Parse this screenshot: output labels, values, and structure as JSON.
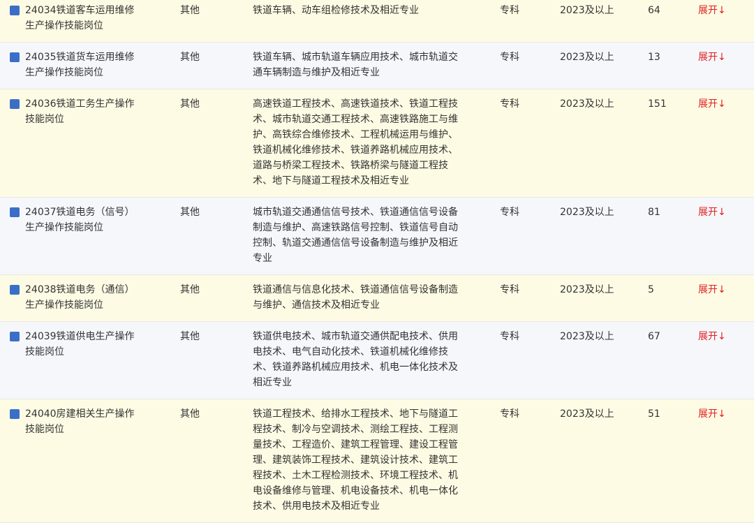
{
  "colors": {
    "row_odd_bg": "#fefbe4",
    "row_even_bg": "#f6f7fb",
    "marker": "#3b6fc7",
    "expand_link": "#e02020"
  },
  "expand_icon": "down-arrow-icon",
  "rows": [
    {
      "name": "24034铁道客车运用维修生产操作技能岗位",
      "type": "其他",
      "major": "铁道车辆、动车组检修技术及相近专业",
      "education": "专科",
      "year": "2023及以上",
      "count": "64",
      "action": "展开↓"
    },
    {
      "name": "24035铁道货车运用维修生产操作技能岗位",
      "type": "其他",
      "major": "铁道车辆、城市轨道车辆应用技术、城市轨道交通车辆制造与维护及相近专业",
      "education": "专科",
      "year": "2023及以上",
      "count": "13",
      "action": "展开↓"
    },
    {
      "name": "24036铁道工务生产操作技能岗位",
      "type": "其他",
      "major": "高速铁道工程技术、高速铁道技术、铁道工程技术、城市轨道交通工程技术、高速铁路施工与维护、高铁综合维修技术、工程机械运用与维护、铁道机械化维修技术、铁道养路机械应用技术、道路与桥梁工程技术、铁路桥梁与隧道工程技术、地下与隧道工程技术及相近专业",
      "education": "专科",
      "year": "2023及以上",
      "count": "151",
      "action": "展开↓"
    },
    {
      "name": "24037铁道电务（信号）生产操作技能岗位",
      "type": "其他",
      "major": "城市轨道交通通信信号技术、铁道通信信号设备制造与维护、高速铁路信号控制、铁道信号自动控制、轨道交通通信信号设备制造与维护及相近专业",
      "education": "专科",
      "year": "2023及以上",
      "count": "81",
      "action": "展开↓"
    },
    {
      "name": "24038铁道电务（通信）生产操作技能岗位",
      "type": "其他",
      "major": "铁道通信与信息化技术、铁道通信信号设备制造与维护、通信技术及相近专业",
      "education": "专科",
      "year": "2023及以上",
      "count": "5",
      "action": "展开↓"
    },
    {
      "name": "24039铁道供电生产操作技能岗位",
      "type": "其他",
      "major": "铁道供电技术、城市轨道交通供配电技术、供用电技术、电气自动化技术、铁道机械化维修技术、铁道养路机械应用技术、机电一体化技术及相近专业",
      "education": "专科",
      "year": "2023及以上",
      "count": "67",
      "action": "展开↓"
    },
    {
      "name": "24040房建相关生产操作技能岗位",
      "type": "其他",
      "major": "铁道工程技术、给排水工程技术、地下与隧道工程技术、制冷与空调技术、测绘工程技、工程测量技术、工程造价、建筑工程管理、建设工程管理、建筑装饰工程技术、建筑设计技术、建筑工程技术、土木工程检测技术、环境工程技术、机电设备维修与管理、机电设备技术、机电一体化技术、供用电技术及相近专业",
      "education": "专科",
      "year": "2023及以上",
      "count": "51",
      "action": "展开↓"
    }
  ]
}
